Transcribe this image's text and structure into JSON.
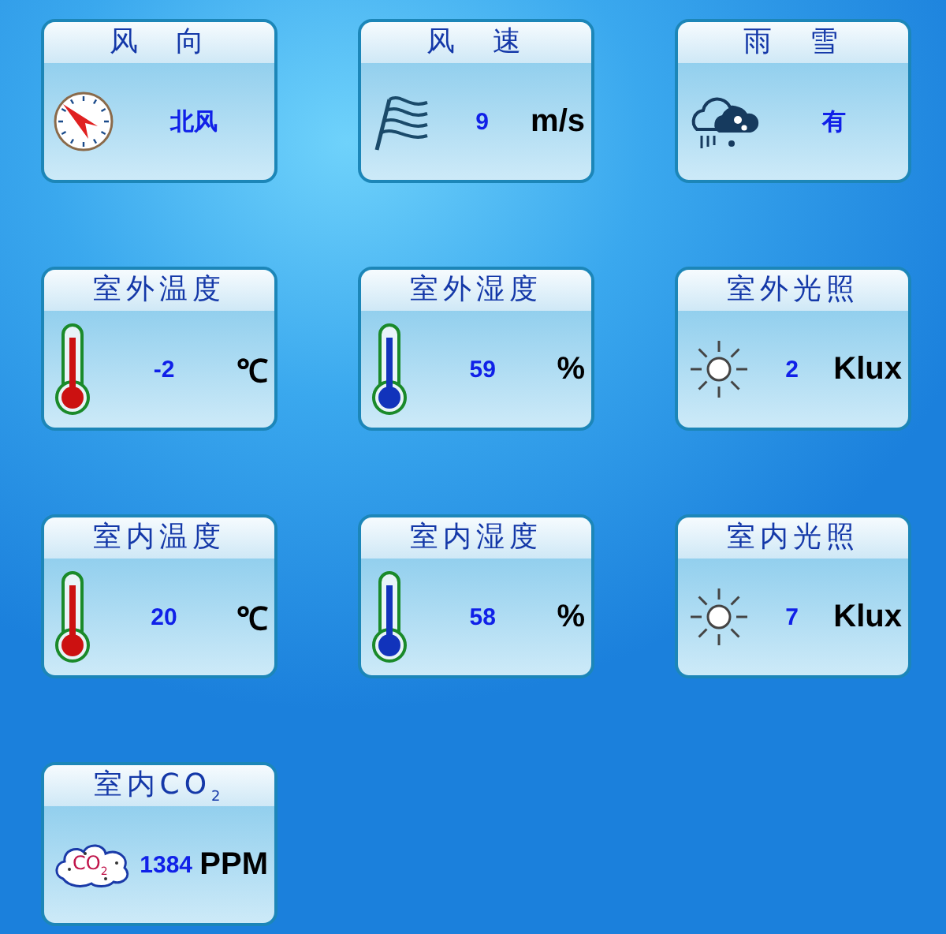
{
  "cards": [
    {
      "title": "风　向",
      "kind": "compass",
      "value": "北风"
    },
    {
      "title": "风　速",
      "kind": "flag",
      "value": "9",
      "unit": "m/s"
    },
    {
      "title": "雨　雪",
      "kind": "rainsnow",
      "value": "有"
    },
    {
      "title": "室外温度",
      "kind": "thermometer",
      "color": "#cc1111",
      "value": "-2",
      "unit": "℃"
    },
    {
      "title": "室外湿度",
      "kind": "thermometer",
      "color": "#1133bb",
      "value": "59",
      "unit": "%"
    },
    {
      "title": "室外光照",
      "kind": "sun",
      "value": "2",
      "unit": "Klux"
    },
    {
      "title": "室内温度",
      "kind": "thermometer",
      "color": "#cc1111",
      "value": "20",
      "unit": "℃"
    },
    {
      "title": "室内湿度",
      "kind": "thermometer",
      "color": "#1133bb",
      "value": "58",
      "unit": "%"
    },
    {
      "title": "室内光照",
      "kind": "sun",
      "value": "7",
      "unit": "Klux"
    },
    {
      "title": "室内CO$_{2}$",
      "kind": "cloud",
      "icon_label": "CO$_{2}$",
      "value": "1384",
      "unit": "PPM"
    }
  ]
}
